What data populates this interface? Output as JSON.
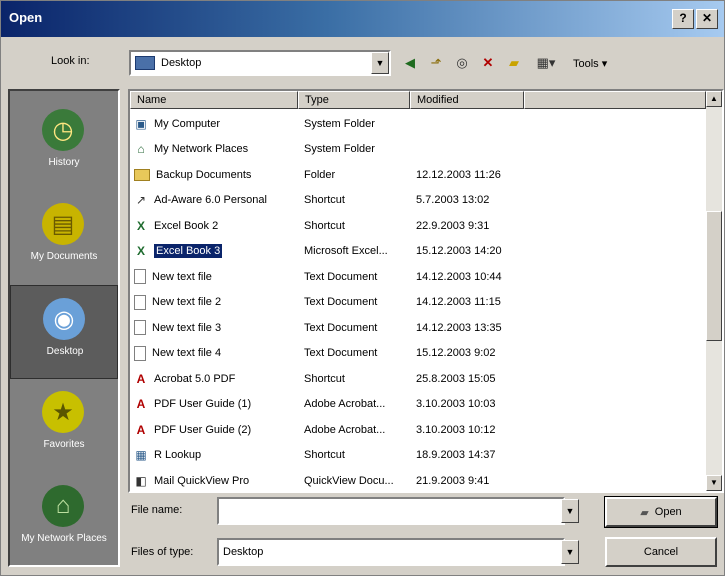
{
  "window": {
    "title": "Open"
  },
  "titlebar": {
    "help_glyph": "?",
    "close_glyph": "✕"
  },
  "lookin": {
    "label": "Look in:",
    "value": "Desktop"
  },
  "toolbar": {
    "tools_label": "Tools ▾",
    "views_glyph": "▦▾"
  },
  "places": [
    {
      "label": "History",
      "icon": "history-icon",
      "selected": false
    },
    {
      "label": "My Documents",
      "icon": "my-documents-icon",
      "selected": false
    },
    {
      "label": "Desktop",
      "icon": "desktop-icon",
      "selected": true
    },
    {
      "label": "Favorites",
      "icon": "favorites-icon",
      "selected": false
    },
    {
      "label": "My Network Places",
      "icon": "network-places-icon",
      "selected": false
    }
  ],
  "columns": {
    "name": "Name",
    "type": "Type",
    "modified": "Modified"
  },
  "files": [
    {
      "name": "My Computer",
      "type": "System Folder",
      "modified": "",
      "icon": "computer"
    },
    {
      "name": "My Network Places",
      "type": "System Folder",
      "modified": "",
      "icon": "network"
    },
    {
      "name": "Backup Documents",
      "type": "Folder",
      "modified": "12.12.2003 11:26",
      "icon": "folder"
    },
    {
      "name": "Ad-Aware 6.0 Personal",
      "type": "Shortcut",
      "modified": "5.7.2003 13:02",
      "icon": "shortcut"
    },
    {
      "name": "Excel Book 2",
      "type": "Shortcut",
      "modified": "22.9.2003 9:31",
      "icon": "excel"
    },
    {
      "name": "Excel Book 3",
      "type": "Microsoft Excel...",
      "modified": "15.12.2003 14:20",
      "icon": "excel"
    },
    {
      "name": "New text file",
      "type": "Text Document",
      "modified": "14.12.2003 10:44",
      "icon": "text"
    },
    {
      "name": "New text file 2",
      "type": "Text Document",
      "modified": "14.12.2003 11:15",
      "icon": "text"
    },
    {
      "name": "New text file 3",
      "type": "Text Document",
      "modified": "14.12.2003 13:35",
      "icon": "text"
    },
    {
      "name": "New text file 4",
      "type": "Text Document",
      "modified": "15.12.2003 9:02",
      "icon": "text"
    },
    {
      "name": "Acrobat 5.0 PDF",
      "type": "Shortcut",
      "modified": "25.8.2003 15:05",
      "icon": "pdf"
    },
    {
      "name": "PDF User Guide (1)",
      "type": "Adobe Acrobat...",
      "modified": "3.10.2003 10:03",
      "icon": "pdf"
    },
    {
      "name": "PDF User Guide (2)",
      "type": "Adobe Acrobat...",
      "modified": "3.10.2003 10:12",
      "icon": "pdf"
    },
    {
      "name": "R Lookup",
      "type": "Shortcut",
      "modified": "18.9.2003 14:37",
      "icon": "app"
    },
    {
      "name": "Mail QuickView Pro",
      "type": "QuickView Docu...",
      "modified": "21.9.2003 9:41",
      "icon": "quickview"
    }
  ],
  "selected_file_index": 5,
  "filename": {
    "label": "File name:",
    "value": ""
  },
  "filetype": {
    "label": "Files of type:",
    "value": "Desktop"
  },
  "buttons": {
    "open": "Open",
    "cancel": "Cancel"
  }
}
